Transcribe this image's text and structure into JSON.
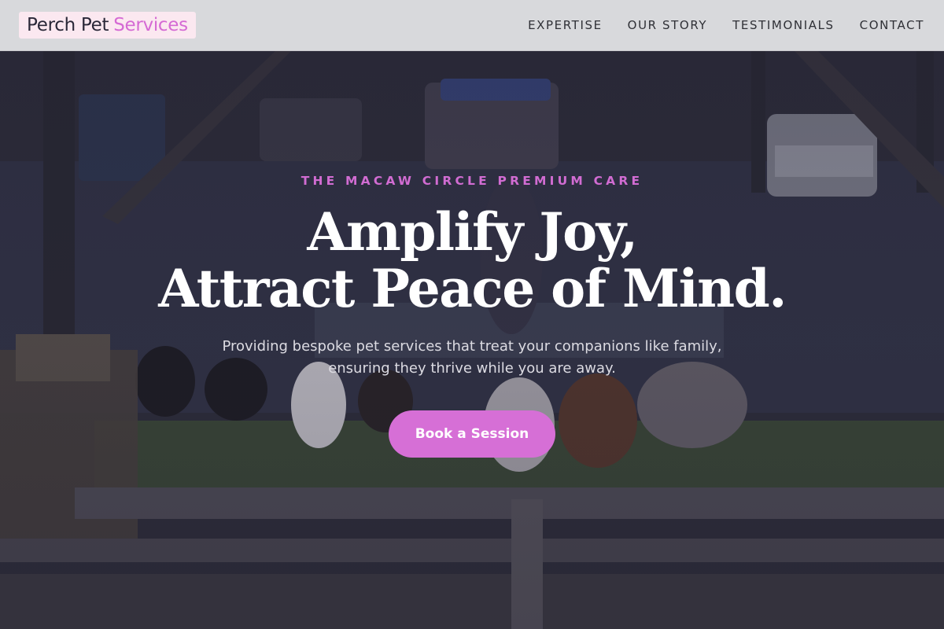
{
  "nav": {
    "logo_part1": "Perch Pet",
    "logo_part2": "Services",
    "links": [
      "EXPERTISE",
      "OUR STORY",
      "TESTIMONIALS",
      "CONTACT"
    ]
  },
  "hero": {
    "eyebrow": "THE MACAW CIRCLE PREMIUM CARE",
    "headline_line1": "Amplify Joy,",
    "headline_line2": "Attract Peace of Mind.",
    "subtitle_line1": "Providing bespoke pet services that treat your companions like family,",
    "subtitle_line2": "ensuring they thrive while you are away.",
    "cta_label": "Book a Session",
    "background_image": "photo"
  },
  "colors": {
    "accent": "#d66fd6",
    "nav_bg": "#d8d9dc",
    "text_dark": "#2a2838"
  }
}
